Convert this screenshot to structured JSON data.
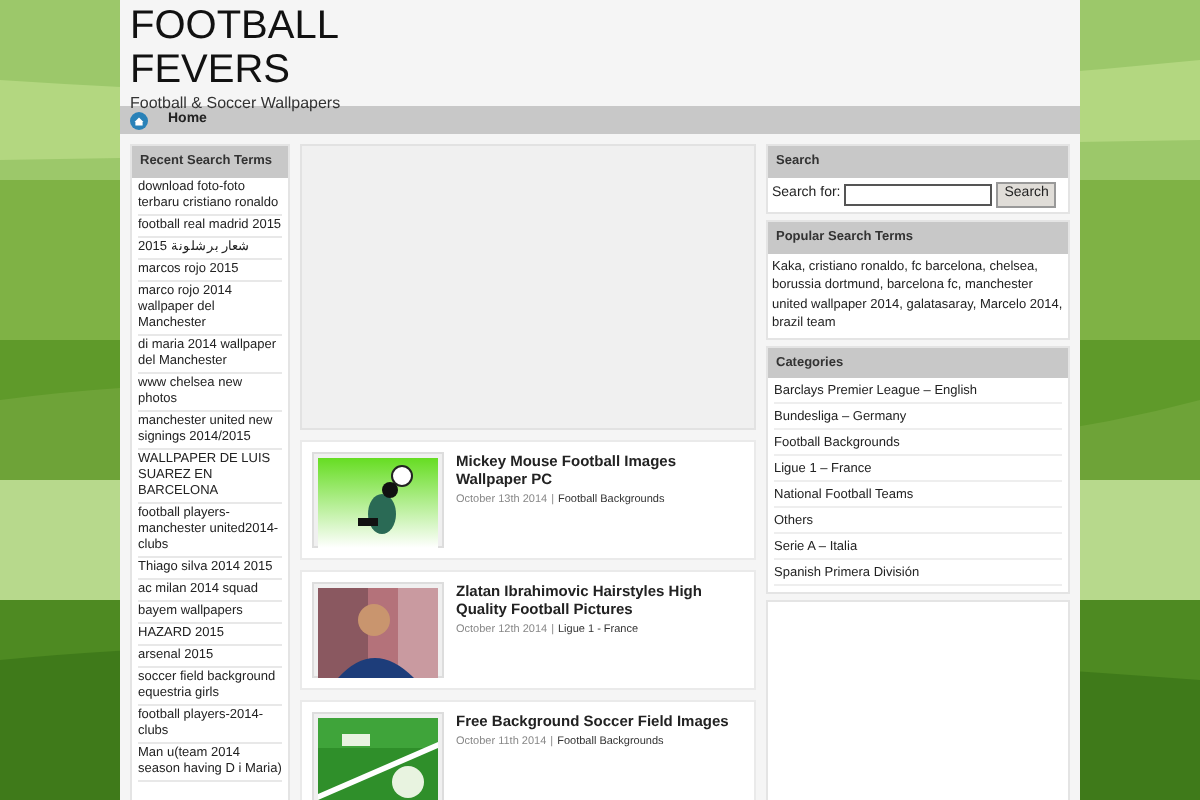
{
  "site": {
    "title_lines": [
      "FOOTBALL",
      "FEVERS"
    ],
    "tagline": "Football & Soccer Wallpapers"
  },
  "nav": [
    {
      "label": "Home",
      "selected": true
    }
  ],
  "recent": {
    "heading": "Recent Search Terms",
    "items": [
      "download foto-foto terbaru cristiano ronaldo",
      "football real madrid 2015",
      "شعار برشلونة 2015",
      "marcos rojo 2015",
      "marco rojo 2014 wallpaper del Manchester",
      "di maria 2014 wallpaper del Manchester",
      "www chelsea new photos",
      "manchester united new signings 2014/2015",
      "WALLPAPER DE LUIS SUAREZ EN BARCELONA",
      "football players-manchester united2014-clubs",
      "Thiago silva 2014 2015",
      "ac milan 2014 squad",
      "bayem wallpapers",
      "HAZARD 2015",
      "arsenal 2015",
      "soccer field background equestria girls",
      "football players-2014-clubs",
      "Man u(team 2014 season having D i Maria)"
    ]
  },
  "posts": [
    {
      "kind": "cartoon",
      "title": "Mickey Mouse Football Images Wallpaper PC",
      "date": "October 13th 2014",
      "separator": "|",
      "category": "Football Backgrounds"
    },
    {
      "kind": "player",
      "title": "Zlatan Ibrahimovic Hairstyles High Quality Football Pictures",
      "date": "October 12th 2014",
      "separator": "|",
      "category": "Ligue 1 - France"
    },
    {
      "kind": "field",
      "title": "Free Background Soccer Field Images",
      "date": "October 11th 2014",
      "separator": "|",
      "category": "Football Backgrounds"
    }
  ],
  "search": {
    "heading": "Search",
    "label": "Search for:",
    "button": "Search"
  },
  "popular": {
    "heading": "Popular Search Terms",
    "text": "Kaka, cristiano ronaldo, fc barcelona, chelsea, borussia dortmund, barcelona fc, manchester united wallpaper 2014, galatasaray, Marcelo 2014, brazil team"
  },
  "categories": {
    "heading": "Categories",
    "items": [
      "Barclays Premier League – English",
      "Bundesliga – Germany",
      "Football Backgrounds",
      "Ligue 1 – France",
      "National Football Teams",
      "Others",
      "Serie A – Italia",
      "Spanish Primera División"
    ]
  }
}
